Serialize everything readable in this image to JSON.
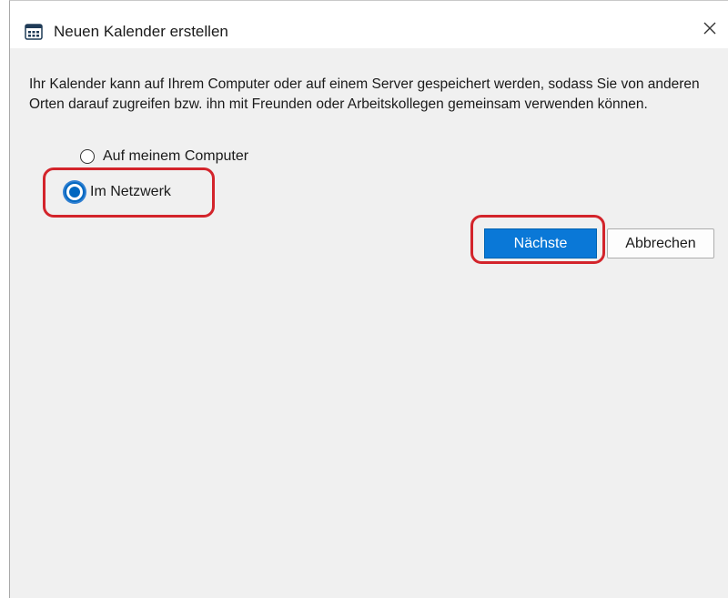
{
  "dialog": {
    "title": "Neuen Kalender erstellen",
    "icon": "calendar-icon",
    "close_icon": "close-icon",
    "description": "Ihr Kalender kann auf Ihrem Computer oder auf einem Server gespeichert werden, sodass Sie von anderen Orten darauf zugreifen bzw. ihn mit Freunden oder Arbeitskollegen gemeinsam verwenden können.",
    "options": [
      {
        "label": "Auf meinem Computer",
        "checked": false
      },
      {
        "label": "Im Netzwerk",
        "checked": true
      }
    ],
    "buttons": {
      "next_label": "Nächste",
      "cancel_label": "Abbrechen"
    }
  },
  "colors": {
    "accent": "#0a78d7",
    "annotation": "#d3242b",
    "dialog_bg": "#f0f0f0"
  }
}
